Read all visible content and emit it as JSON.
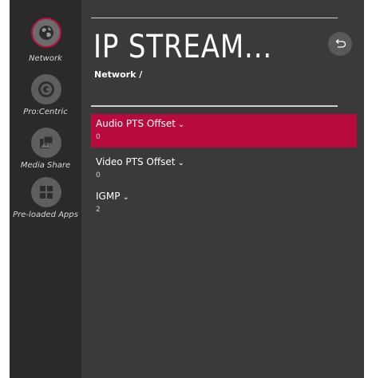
{
  "sidebar": {
    "items": [
      {
        "label": "Network",
        "icon": "globe-icon",
        "active": true
      },
      {
        "label": "Pro:Centric",
        "icon": "procentric-icon",
        "active": false
      },
      {
        "label": "Media Share",
        "icon": "media-share-icon",
        "active": false
      },
      {
        "label": "Pre-loaded Apps",
        "icon": "apps-grid-icon",
        "active": false
      }
    ]
  },
  "header": {
    "title": "IP STREAM...",
    "breadcrumb": "Network /",
    "back_icon": "back-arrow-icon"
  },
  "menu": {
    "items": [
      {
        "label": "Audio PTS Offset",
        "value": "0",
        "selected": true
      },
      {
        "label": "Video PTS Offset",
        "value": "0",
        "selected": false
      },
      {
        "label": "IGMP",
        "value": "2",
        "selected": false
      }
    ],
    "chevron": "⌄"
  },
  "colors": {
    "accent": "#b80a3c",
    "sidebar_bg": "#2a2a2a",
    "content_bg": "#3a3a3a"
  }
}
